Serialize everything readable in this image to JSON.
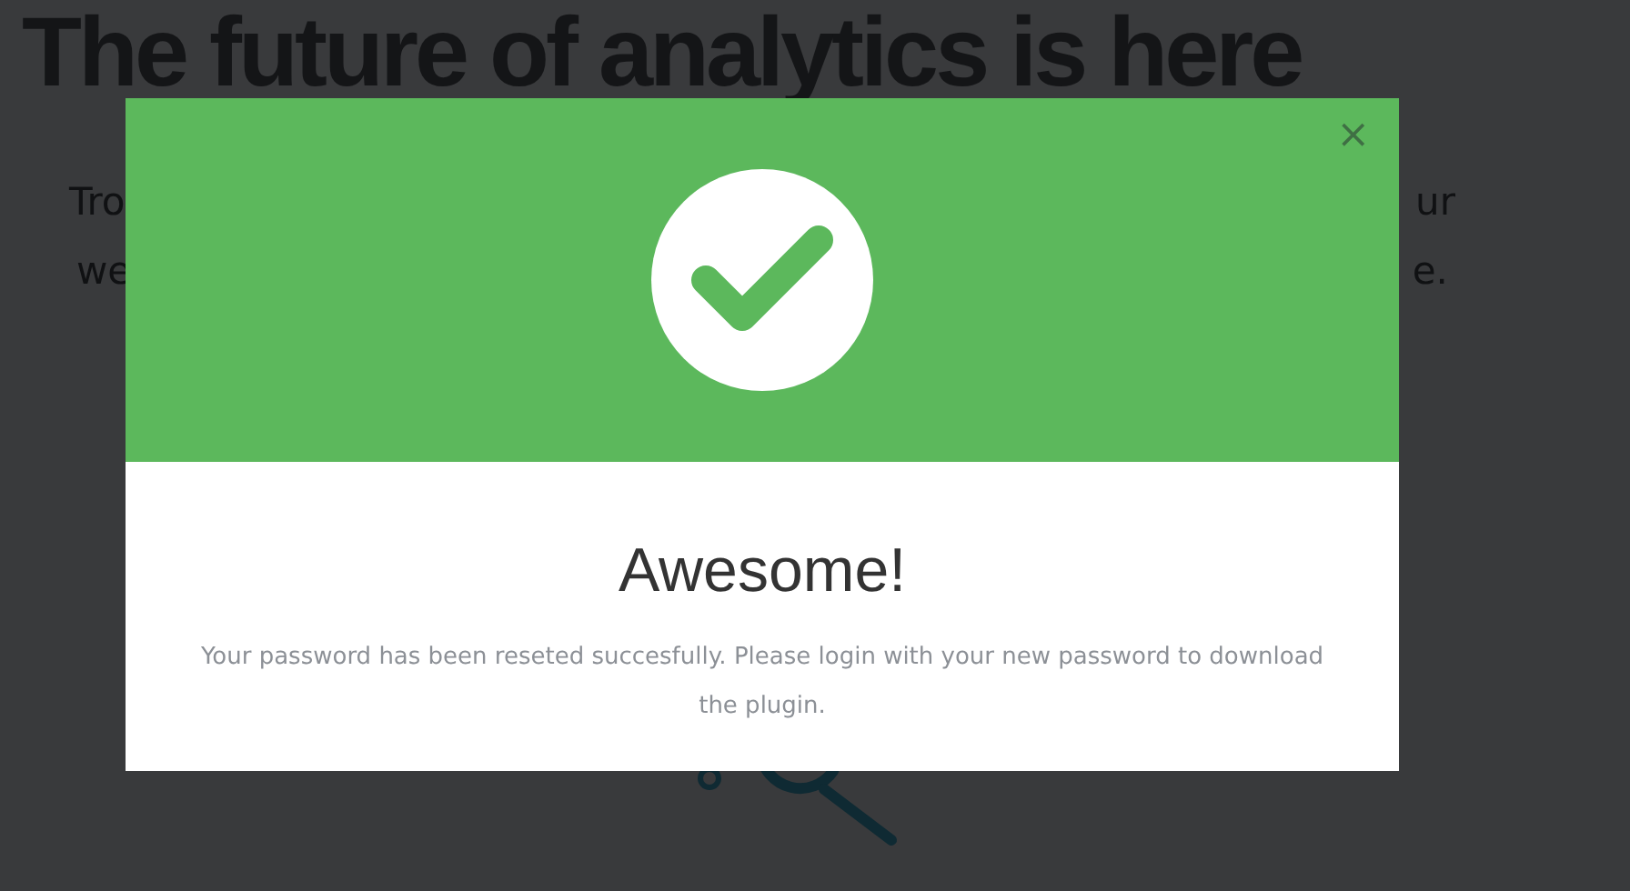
{
  "background": {
    "heading": "The future of analytics is here",
    "paragraph_fragments": [
      {
        "left": "Tro",
        "right": "ur"
      },
      {
        "left": "we",
        "right": "e."
      }
    ]
  },
  "modal": {
    "close": "×",
    "title": "Awesome!",
    "message": "Your password has been reseted succesfully. Please login with your new password to download the plugin."
  }
}
